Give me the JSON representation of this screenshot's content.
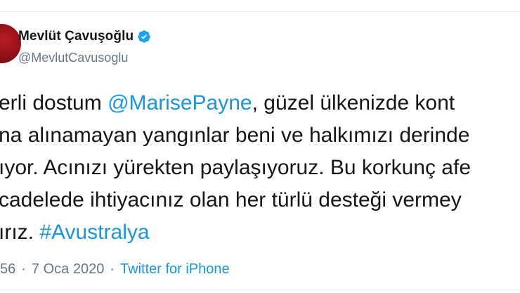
{
  "author": {
    "display_name": "Mevlüt Çavuşoğlu",
    "handle": "@MevlutCavusoglu",
    "verified": true,
    "avatar_icon": "profile-avatar"
  },
  "tweet": {
    "line1_pre": "erli dostum ",
    "line1_mention": "@MarisePayne",
    "line1_post": ", güzel ülkenizde kont",
    "line2": "na alınamayan yangınlar beni ve halkımızı derinde",
    "line3": "ıyor. Acınızı yürekten paylaşıyoruz. Bu korkunç afe",
    "line4": "cadelede ihtiyacınız olan her türlü desteği vermey",
    "line5_pre": "ırız. ",
    "line5_hashtag": "#Avustralya"
  },
  "meta": {
    "time": "56",
    "separator": "·",
    "date": "7 Oca 2020",
    "separator2": "·",
    "source": "Twitter for iPhone"
  },
  "colors": {
    "link": "#1b95e0",
    "muted": "#657786",
    "text": "#14171a",
    "verified": "#1da1f2"
  }
}
